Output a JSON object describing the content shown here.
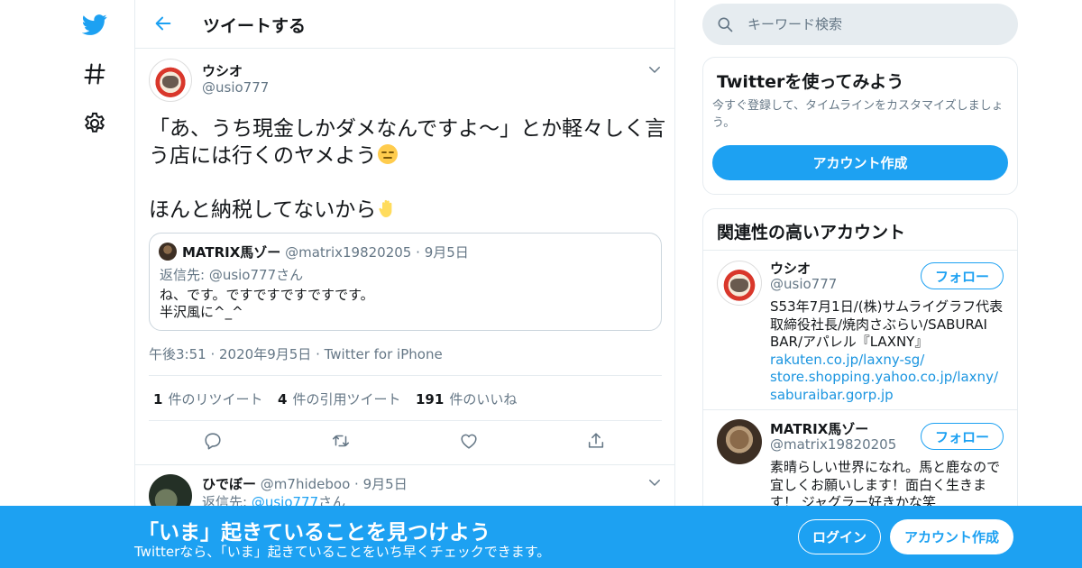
{
  "theme": {
    "accent": "#1da1f2",
    "text": "#14171a",
    "muted": "#657786",
    "border": "#e6ecf0"
  },
  "nav": {
    "icons": [
      "twitter-bird-icon",
      "hashtag-icon",
      "gear-icon"
    ]
  },
  "header": {
    "title": "ツイートする",
    "back_icon": "arrow-left-icon"
  },
  "tweet": {
    "author_name": "ウシオ",
    "author_handle": "@usio777",
    "text": "「あ、うち現金しかダメなんですよ〜」とか軽々しく言う店には行くのヤメよう",
    "emoji1": "expressionless-face",
    "text2": "ほんと納税してないから",
    "emoji2": "raised-hand",
    "quote": {
      "name": "MATRIX馬ゾー",
      "handle": "@matrix19820205",
      "date": "9月5日",
      "reply_to": "返信先: @usio777さん",
      "text": "ね、です。ですですですですです。\n半沢風に^_^"
    },
    "time": "午後3:51",
    "date": "2020年9月5日",
    "source": "Twitter for iPhone",
    "stats": {
      "retweets": "1",
      "retweets_label": "件のリツイート",
      "quotes": "4",
      "quotes_label": "件の引用ツイート",
      "likes": "191",
      "likes_label": "件のいいね"
    }
  },
  "reply": {
    "name": "ひでぼー",
    "handle": "@m7hideboo",
    "date": "9月5日",
    "reply_prefix": "返信先: ",
    "reply_mention": "@usio777",
    "reply_suffix": "さん"
  },
  "sidebar": {
    "search_placeholder": "キーワード検索",
    "try": {
      "title": "Twitterを使ってみよう",
      "desc": "今すぐ登録して、タイムラインをカスタマイズしましょう。",
      "button": "アカウント作成"
    },
    "related": {
      "title": "関連性の高いアカウント",
      "follow_label": "フォロー",
      "accounts": [
        {
          "name": "ウシオ",
          "handle": "@usio777",
          "bio": "S53年7月1日/(株)サムライグラフ代表取締役社長/焼肉さぶらい/SABURAI BAR/アパレル『LAXNY』",
          "links": [
            "rakuten.co.jp/laxny-sg/",
            "store.shopping.yahoo.co.jp/laxny/",
            "saburaibar.gorp.jp"
          ]
        },
        {
          "name": "MATRIX馬ゾー",
          "handle": "@matrix19820205",
          "bio": "素晴らしい世界になれ。馬と鹿なので宜しくお願いします！面白く生きます！ ジャグラー好きかな笑"
        }
      ]
    }
  },
  "banner": {
    "title": "「いま」起きていることを見つけよう",
    "subtitle": "Twitterなら、「いま」起きていることをいち早くチェックできます。",
    "login": "ログイン",
    "signup": "アカウント作成"
  }
}
